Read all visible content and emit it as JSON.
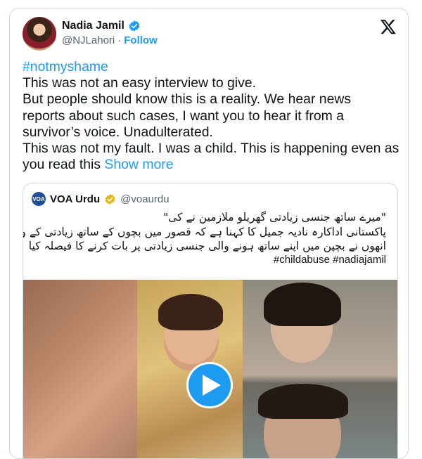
{
  "tweet": {
    "author_name": "Nadia Jamil",
    "author_handle": "@NJLahori",
    "separator": "·",
    "follow_label": "Follow",
    "hashtag": "#notmyshame",
    "lines": [
      "This was not an easy interview to give.",
      "But people should know this is a reality. We hear news",
      "reports about such cases, I want you to hear it from a",
      "survivor’s voice. Unadulterated.",
      "This was not my fault. I was a child. This is happening even as"
    ],
    "last_line_prefix": "you read this",
    "show_more_label": "Show more"
  },
  "quoted": {
    "logo_text": "VOA",
    "name": "VOA Urdu",
    "handle": "@voaurdu",
    "urdu_lines": [
      "\"میرے ساتھ جنسی زیادتی گھریلو ملازمین نے کی\"",
      "پاکستانی اداکارہ نادیہ جمیل کا کہنا ہے کہ قصور میں بچوں کے ساتھ زیادتی کے واقعات کے منظر عام پر آنے کے بعد",
      "انھوں نے بچپن میں اپنے ساتھ ہونے والی جنسی زیادتی پر بات کرنے کا فیصلہ کیا"
    ],
    "tags": "#childabuse #nadiajamil"
  },
  "colors": {
    "accent": "#1d9bf0",
    "verified_gold": "#e2b719",
    "muted": "#536471"
  },
  "icons": [
    "x-logo-icon",
    "verified-badge-icon",
    "gold-verified-badge-icon",
    "play-icon"
  ]
}
